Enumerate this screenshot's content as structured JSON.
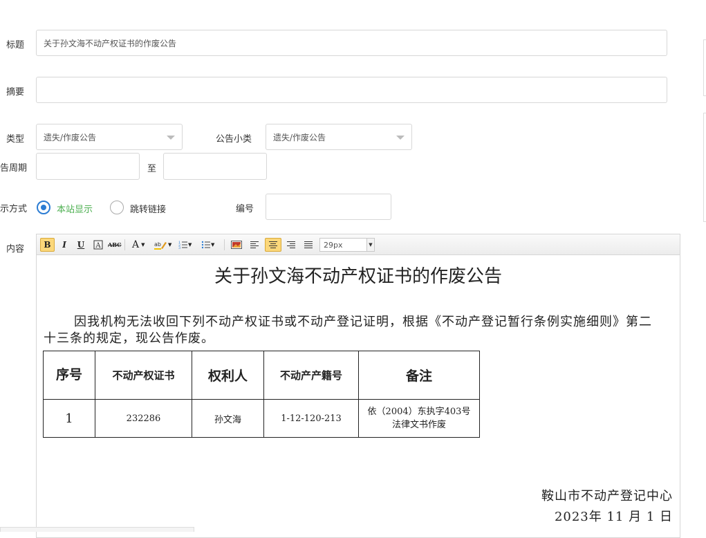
{
  "form": {
    "title_label": "标题",
    "title_value": "关于孙文海不动产权证书的作废公告",
    "summary_label": "摘要",
    "summary_value": "",
    "type_label": "类型",
    "type_value": "遗失/作废公告",
    "subtype_label": "公告小类",
    "subtype_value": "遗失/作废公告",
    "period_label": "告周期",
    "period_from": "",
    "period_to_label": "至",
    "period_to": "",
    "display_label": "示方式",
    "display_options": [
      "本站显示",
      "跳转链接"
    ],
    "display_selected": "本站显示",
    "number_label": "编号",
    "number_value": "",
    "content_label": "内容"
  },
  "toolbar": {
    "bold": "B",
    "italic": "I",
    "underline": "U",
    "font_size": "29px"
  },
  "document": {
    "title": "关于孙文海不动产权证书的作废公告",
    "paragraph": "因我机构无法收回下列不动产权证书或不动产登记证明，根据《不动产登记暂行条例实施细则》第二十三条的规定，现公告作废。",
    "table": {
      "headers": [
        "序号",
        "不动产权证书",
        "权利人",
        "不动产产籍号",
        "备注"
      ],
      "rows": [
        [
          "1",
          "232286",
          "孙文海",
          "1-12-120-213",
          "依（2004）东执字403号法律文书作废"
        ]
      ]
    },
    "signature_org": "鞍山市不动产登记中心",
    "signature_date": "2023年 11 月 1 日"
  },
  "colors": {
    "accent": "#2b7cd3",
    "selected_text": "#4caf50",
    "active_button": "#fbd77a"
  }
}
